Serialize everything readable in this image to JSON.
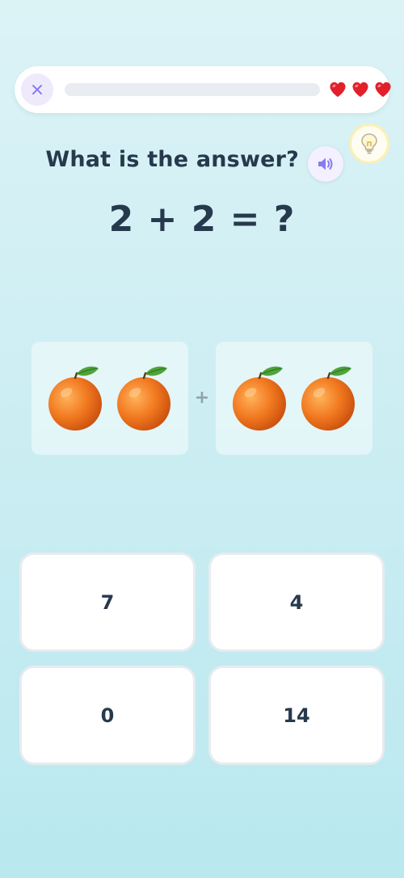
{
  "header": {
    "close_icon": "close-icon",
    "progress": 0,
    "lives": 3,
    "heart_icon": "heart-icon",
    "heart_color": "#e2202b"
  },
  "hint": {
    "icon": "lightbulb-icon"
  },
  "question": {
    "text": "What is the answer?",
    "audio_icon": "speaker-icon",
    "equation": "2 + 2 = ?"
  },
  "visual": {
    "left_group_count": 2,
    "right_group_count": 2,
    "item_icon": "orange-icon",
    "operator": "+"
  },
  "answers": [
    "7",
    "4",
    "0",
    "14"
  ],
  "colors": {
    "text": "#26394d",
    "accent": "#8a7cf0",
    "background": "#cdeef3"
  }
}
